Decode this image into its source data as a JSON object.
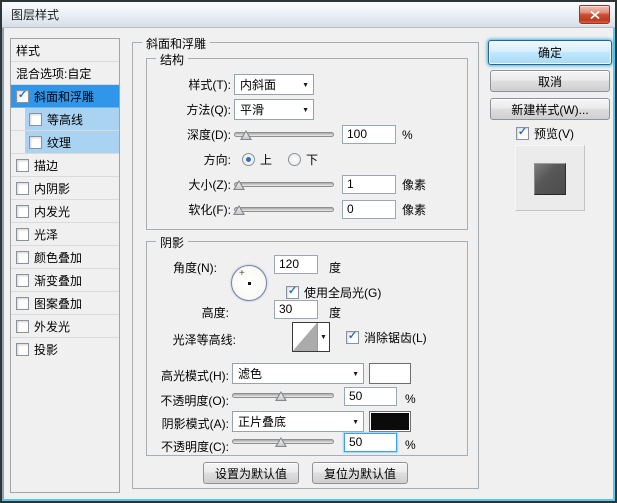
{
  "window": {
    "title": "图层样式"
  },
  "sidebar": {
    "header": "样式",
    "blend_option": "混合选项:自定",
    "items": [
      {
        "label": "斜面和浮雕",
        "checked": true,
        "state": "selected"
      },
      {
        "label": "等高线",
        "checked": false,
        "state": "sub"
      },
      {
        "label": "纹理",
        "checked": false,
        "state": "sub"
      },
      {
        "label": "描边",
        "checked": false
      },
      {
        "label": "内阴影",
        "checked": false
      },
      {
        "label": "内发光",
        "checked": false
      },
      {
        "label": "光泽",
        "checked": false
      },
      {
        "label": "颜色叠加",
        "checked": false
      },
      {
        "label": "渐变叠加",
        "checked": false
      },
      {
        "label": "图案叠加",
        "checked": false
      },
      {
        "label": "外发光",
        "checked": false
      },
      {
        "label": "投影",
        "checked": false
      }
    ]
  },
  "panel": {
    "title": "斜面和浮雕",
    "structure": {
      "legend": "结构",
      "style_label": "样式(T):",
      "style_value": "内斜面",
      "technique_label": "方法(Q):",
      "technique_value": "平滑",
      "depth_label": "深度(D):",
      "depth_value": "100",
      "depth_unit": "%",
      "direction_label": "方向:",
      "direction_up": "上",
      "direction_down": "下",
      "size_label": "大小(Z):",
      "size_value": "1",
      "size_unit": "像素",
      "soften_label": "软化(F):",
      "soften_value": "0",
      "soften_unit": "像素"
    },
    "shading": {
      "legend": "阴影",
      "angle_label": "角度(N):",
      "angle_value": "120",
      "angle_unit": "度",
      "global_light": "使用全局光(G)",
      "altitude_label": "高度:",
      "altitude_value": "30",
      "altitude_unit": "度",
      "gloss_label": "光泽等高线:",
      "antialias": "消除锯齿(L)",
      "highlight_mode_label": "高光模式(H):",
      "highlight_mode_value": "滤色",
      "highlight_opacity_label": "不透明度(O):",
      "highlight_opacity_value": "50",
      "highlight_opacity_unit": "%",
      "shadow_mode_label": "阴影模式(A):",
      "shadow_mode_value": "正片叠底",
      "shadow_opacity_label": "不透明度(C):",
      "shadow_opacity_value": "50",
      "shadow_opacity_unit": "%"
    },
    "footer": {
      "set_default": "设置为默认值",
      "reset_default": "复位为默认值"
    }
  },
  "actions": {
    "ok": "确定",
    "cancel": "取消",
    "new_style": "新建样式(W)...",
    "preview": "预览(V)"
  },
  "colors": {
    "selected_item_bg": "#3096e9",
    "sub_item_bg": "#a9d3f0",
    "highlight_swatch": "#ffffff",
    "shadow_swatch": "#0b0b0b",
    "close_button": "#c94d31"
  }
}
